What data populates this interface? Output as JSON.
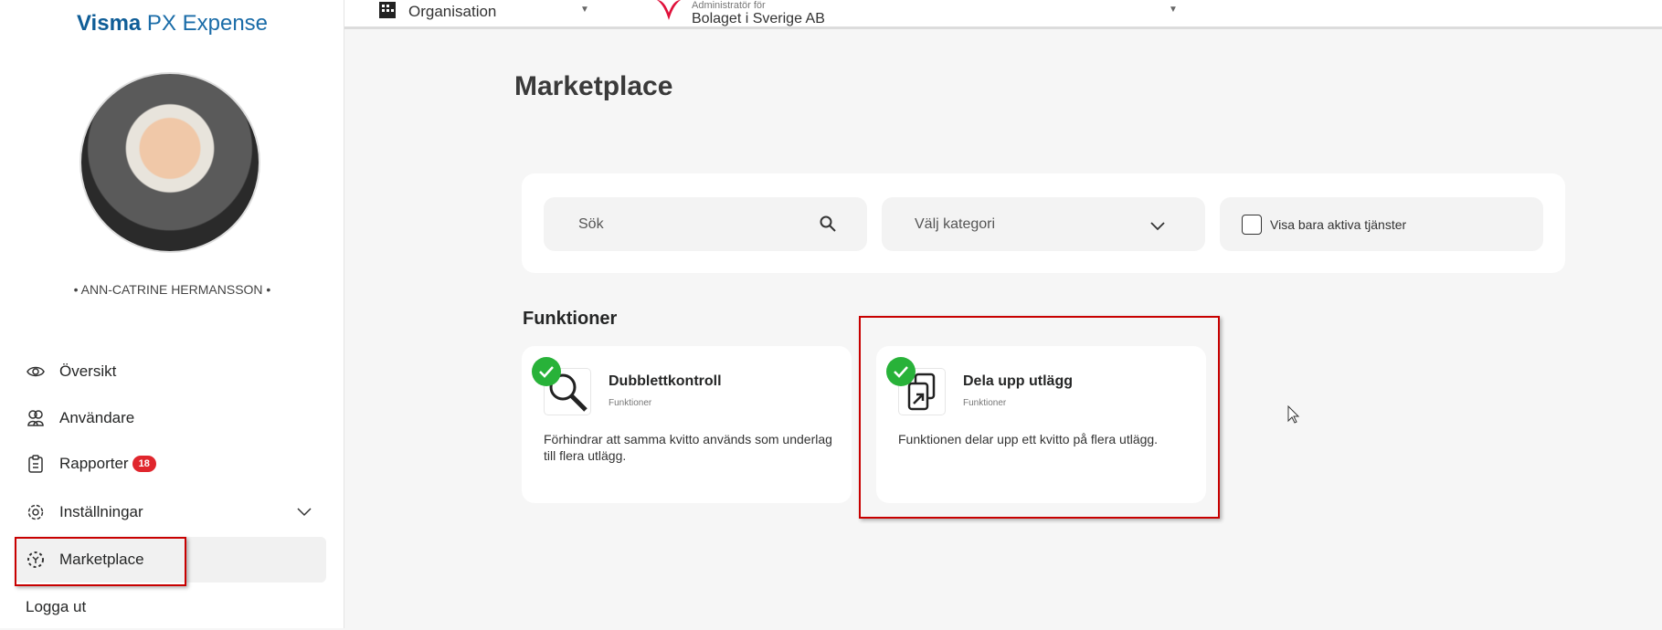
{
  "app": {
    "brand_bold": "Visma",
    "brand_rest": " PX Expense"
  },
  "user": {
    "name": "• ANN-CATRINE HERMANSSON •"
  },
  "sidebar": {
    "items": [
      {
        "label": "Översikt",
        "icon": "eye-icon"
      },
      {
        "label": "Användare",
        "icon": "users-icon"
      },
      {
        "label": "Rapporter",
        "icon": "clipboard-icon",
        "badge": "18"
      },
      {
        "label": "Inställningar",
        "icon": "gear-icon"
      },
      {
        "label": "Marketplace",
        "icon": "marketplace-icon"
      }
    ],
    "logout": "Logga ut"
  },
  "topbar": {
    "org_label": "Organisation",
    "admin_label": "Administratör för",
    "company": "Bolaget i Sverige AB"
  },
  "main": {
    "title": "Marketplace",
    "search_placeholder": "Sök",
    "category_placeholder": "Välj kategori",
    "active_only_label": "Visa bara aktiva tjänster",
    "section": "Funktioner",
    "cards": [
      {
        "title": "Dubblettkontroll",
        "category": "Funktioner",
        "description": "Förhindrar att samma kvitto används som underlag till flera utlägg.",
        "active": true
      },
      {
        "title": "Dela upp utlägg",
        "category": "Funktioner",
        "description": "Funktionen delar upp ett kvitto på flera utlägg.",
        "active": true
      }
    ]
  },
  "colors": {
    "accent": "#1a6ca8",
    "badge": "#e0262d",
    "check": "#28b239",
    "highlight": "#c80000"
  }
}
